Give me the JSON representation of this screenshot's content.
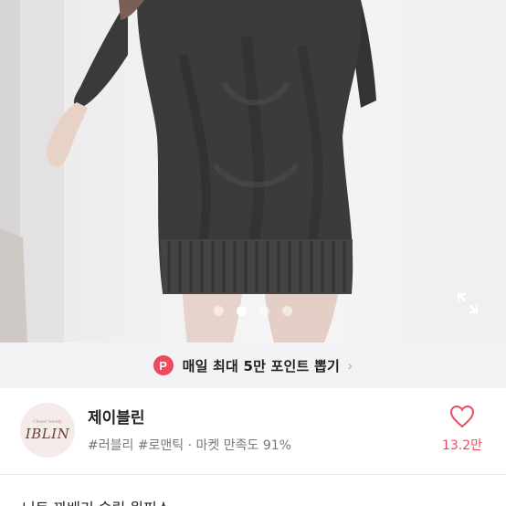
{
  "product_image": {
    "alt": "product photo",
    "carousel": {
      "count": 4,
      "active_index": 1
    }
  },
  "promo": {
    "badge": "P",
    "text": "매일 최대 5만 포인트 뽑기",
    "chevron": "›",
    "color": "#ec4b5f"
  },
  "store": {
    "logo_text": "IBLIN",
    "logo_small": "Cheer lovely",
    "name": "제이블린",
    "tags": "#러블리 #로맨틱 · 마켓 만족도 91%",
    "likes": "13.2만"
  },
  "description": {
    "partial_text": "니트 꽈배기 슬림 원피스"
  },
  "icons": {
    "expand": "expand-icon",
    "heart": "heart-icon",
    "chevron": "chevron-right-icon"
  }
}
